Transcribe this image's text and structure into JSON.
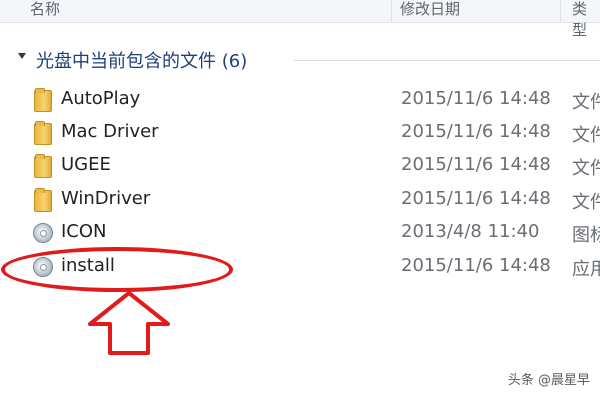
{
  "columns": {
    "name": "名称",
    "date": "修改日期",
    "type": "类型"
  },
  "group": {
    "title": "光盘中当前包含的文件 (6)"
  },
  "files": [
    {
      "name": "AutoPlay",
      "date": "2015/11/6 14:48",
      "type": "文件",
      "icon": "folder-icon"
    },
    {
      "name": "Mac Driver",
      "date": "2015/11/6 14:48",
      "type": "文件",
      "icon": "folder-icon"
    },
    {
      "name": "UGEE",
      "date": "2015/11/6 14:48",
      "type": "文件",
      "icon": "folder-icon"
    },
    {
      "name": "WinDriver",
      "date": "2015/11/6 14:48",
      "type": "文件",
      "icon": "folder-icon"
    },
    {
      "name": "ICON",
      "date": "2013/4/8 11:40",
      "type": "图标",
      "icon": "disc-icon"
    },
    {
      "name": "install",
      "date": "2015/11/6 14:48",
      "type": "应用",
      "icon": "disc-icon"
    }
  ],
  "annotation_color": "#e11b1b",
  "watermark": "头条 @晨星早"
}
